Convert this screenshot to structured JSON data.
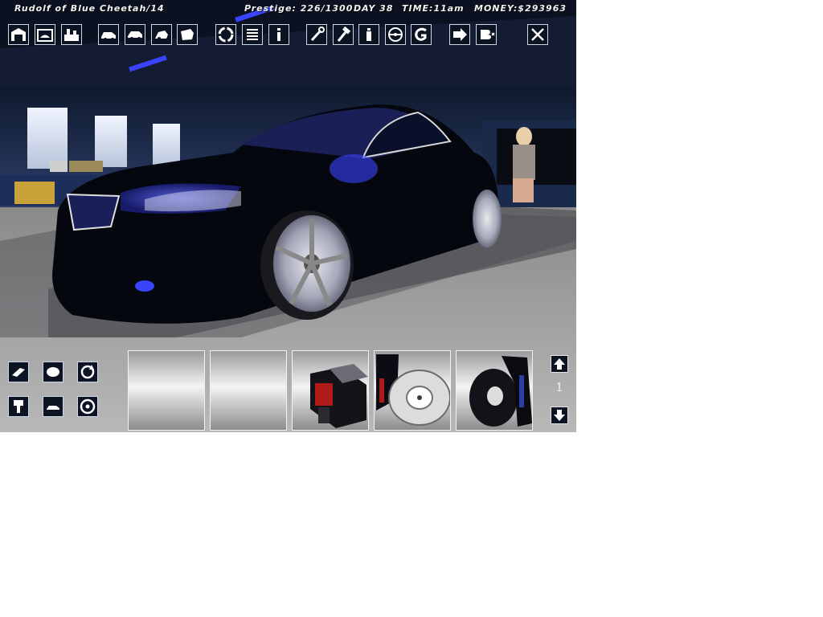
{
  "status_bar": {
    "player": "Rudolf of Blue Cheetah/14",
    "prestige": "Prestige: 226/1300",
    "day": "DAY 38",
    "time": "TIME:11am",
    "money": "MONEY:$293963"
  },
  "toolbar": {
    "icons": [
      "garage-icon",
      "workshop-icon",
      "parts-shop-icon",
      "car-dealer-icon",
      "buy-car-icon",
      "sell-car-icon",
      "car-lot-icon",
      "recycle-icon",
      "list-icon",
      "info-icon",
      "wrench-icon",
      "hammer-icon",
      "spray-icon",
      "steering-wheel-icon",
      "g-icon",
      "arrow-icon",
      "b-icon",
      "close-icon"
    ]
  },
  "left_panel": {
    "icons": [
      "remove-part-icon",
      "part-hand-icon",
      "rotate-icon",
      "install-icon",
      "car-icon",
      "disc-icon"
    ]
  },
  "parts": {
    "slots": [
      "empty",
      "empty",
      "engine-part",
      "brake-disc",
      "brake-caliper-disc"
    ],
    "page": "1"
  },
  "colors": {
    "accent": "#2233ff",
    "car_body": "#05070f",
    "ui_border": "#cfd6e6"
  }
}
